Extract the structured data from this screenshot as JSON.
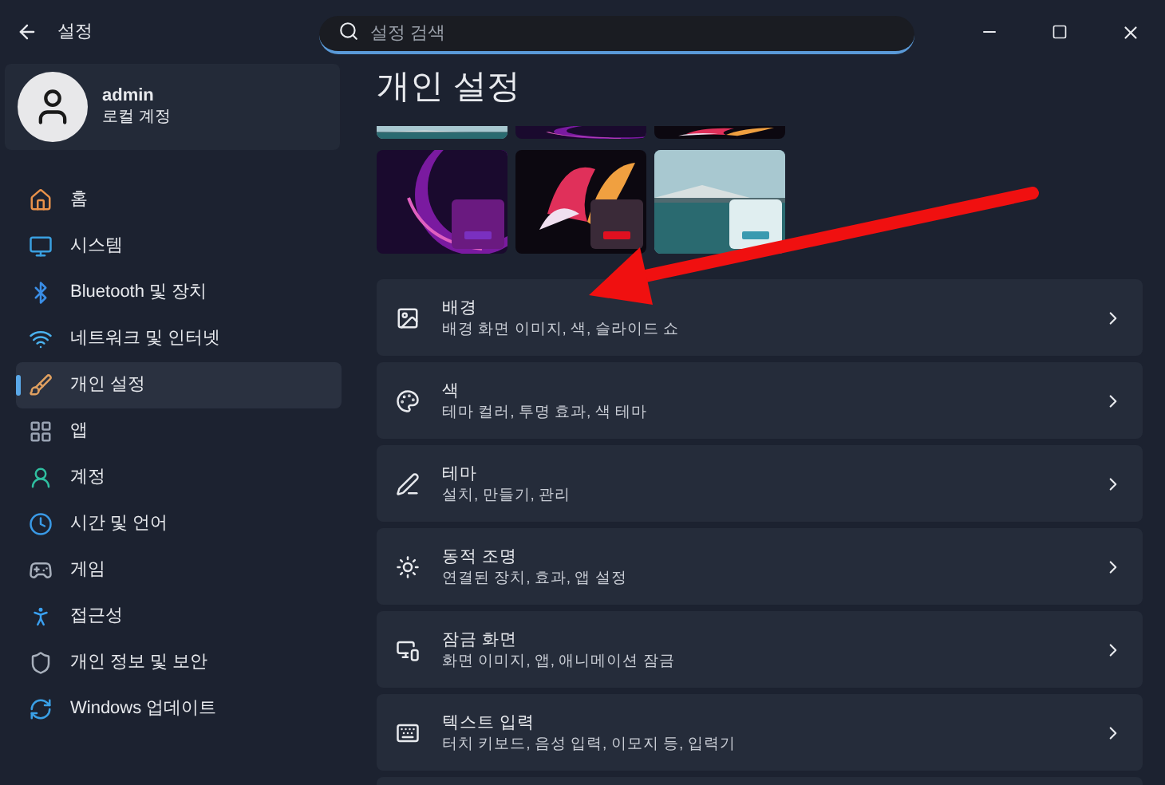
{
  "window": {
    "title": "설정"
  },
  "search": {
    "placeholder": "설정 검색"
  },
  "account": {
    "name": "admin",
    "type": "로컬 계정"
  },
  "sidebar": {
    "items": [
      {
        "label": "홈",
        "selected": false
      },
      {
        "label": "시스템",
        "selected": false
      },
      {
        "label": "Bluetooth 및 장치",
        "selected": false
      },
      {
        "label": "네트워크 및 인터넷",
        "selected": false
      },
      {
        "label": "개인 설정",
        "selected": true
      },
      {
        "label": "앱",
        "selected": false
      },
      {
        "label": "계정",
        "selected": false
      },
      {
        "label": "시간 및 언어",
        "selected": false
      },
      {
        "label": "게임",
        "selected": false
      },
      {
        "label": "접근성",
        "selected": false
      },
      {
        "label": "개인 정보 및 보안",
        "selected": false
      },
      {
        "label": "Windows 업데이트",
        "selected": false
      }
    ]
  },
  "page": {
    "title": "개인 설정"
  },
  "settings": [
    {
      "title": "배경",
      "description": "배경 화면 이미지, 색, 슬라이드 쇼"
    },
    {
      "title": "색",
      "description": "테마 컬러, 투명 효과, 색 테마"
    },
    {
      "title": "테마",
      "description": "설치, 만들기, 관리"
    },
    {
      "title": "동적 조명",
      "description": "연결된 장치, 효과, 앱 설정"
    },
    {
      "title": "잠금 화면",
      "description": "화면 이미지, 앱, 애니메이션 잠금"
    },
    {
      "title": "텍스트 입력",
      "description": "터치 키보드, 음성 입력, 이모지 등, 입력기"
    }
  ]
}
